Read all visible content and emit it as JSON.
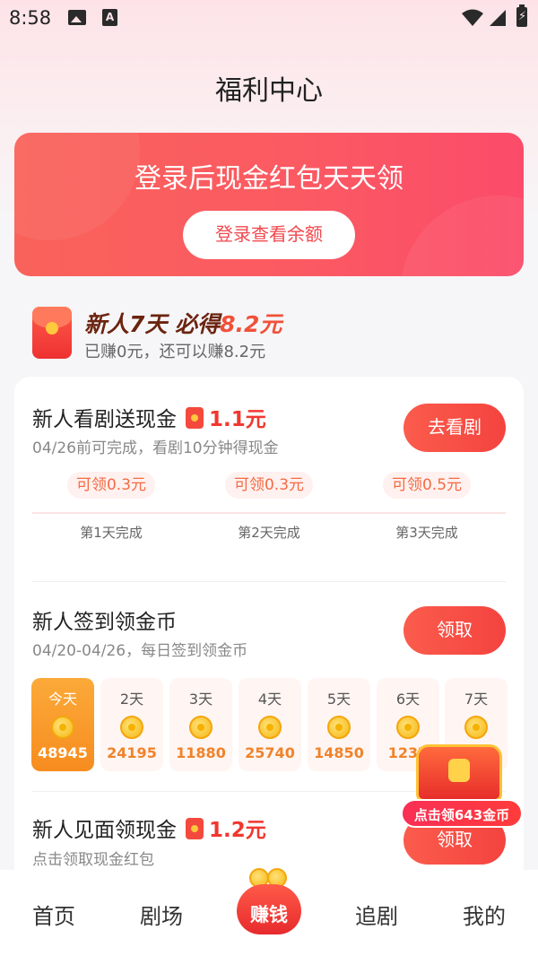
{
  "status_bar": {
    "time": "8:58",
    "a_badge": "A",
    "battery_glyph": "⚡"
  },
  "page": {
    "title": "福利中心"
  },
  "login_banner": {
    "title": "登录后现金红包天天领",
    "button": "登录查看余额"
  },
  "newbie": {
    "title_prefix": "新人7天 必得",
    "title_amount": "8.2元",
    "subtitle": "已赚0元，还可以赚8.2元"
  },
  "tasks": {
    "watch": {
      "title": "新人看剧送现金",
      "amount": "1.1元",
      "subtitle": "04/26前可完成，看剧10分钟得现金",
      "button": "去看剧",
      "steps": [
        {
          "reward": "可领0.3元",
          "label": "第1天完成"
        },
        {
          "reward": "可领0.3元",
          "label": "第2天完成"
        },
        {
          "reward": "可领0.5元",
          "label": "第3天完成"
        }
      ]
    },
    "checkin": {
      "title": "新人签到领金币",
      "subtitle": "04/20-04/26，每日签到领金币",
      "button": "领取",
      "days": [
        {
          "label": "今天",
          "value": "48945",
          "active": true
        },
        {
          "label": "2天",
          "value": "24195"
        },
        {
          "label": "3天",
          "value": "11880"
        },
        {
          "label": "4天",
          "value": "25740"
        },
        {
          "label": "5天",
          "value": "14850"
        },
        {
          "label": "6天",
          "value": "1237"
        },
        {
          "label": "7天",
          "value": ""
        }
      ]
    },
    "meet": {
      "title": "新人见面领现金",
      "amount": "1.2元",
      "subtitle": "点击领取现金红包",
      "button": "领取"
    }
  },
  "floating_chest": {
    "badge": "点击领643金币"
  },
  "bottom_nav": {
    "items": [
      {
        "label": "首页"
      },
      {
        "label": "剧场"
      },
      {
        "label": "追剧"
      },
      {
        "label": "我的"
      }
    ],
    "center_label": "赚钱"
  },
  "colors": {
    "accent": "#f4433f",
    "coin": "#f5b712",
    "active_day": "#f78c1f"
  }
}
